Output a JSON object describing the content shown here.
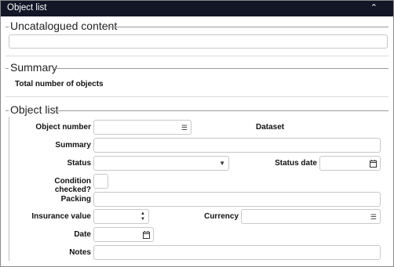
{
  "window": {
    "title": "Object list"
  },
  "sections": {
    "uncatalogued": {
      "legend": "Uncatalogued content"
    },
    "summary": {
      "legend": "Summary",
      "total_label": "Total number of objects"
    },
    "object_list": {
      "legend": "Object list"
    }
  },
  "fields": {
    "object_number": {
      "label": "Object number"
    },
    "dataset": {
      "label": "Dataset"
    },
    "summary": {
      "label": "Summary"
    },
    "status": {
      "label": "Status"
    },
    "status_date": {
      "label": "Status date"
    },
    "condition_checked": {
      "label": "Condition checked?"
    },
    "packing": {
      "label": "Packing"
    },
    "insurance_value": {
      "label": "Insurance value"
    },
    "currency": {
      "label": "Currency"
    },
    "date": {
      "label": "Date"
    },
    "notes": {
      "label": "Notes"
    }
  },
  "icons": {
    "collapse": "chevron-up-icon",
    "list": "list-icon",
    "calendar": "calendar-icon",
    "dropdown": "caret-down-icon",
    "spinner": "spinner-arrows-icon"
  }
}
